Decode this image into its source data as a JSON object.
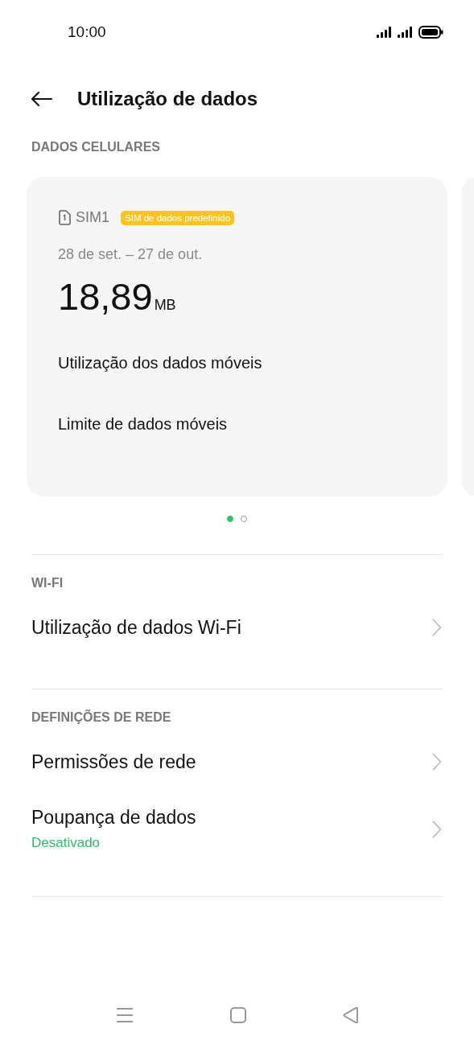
{
  "status_bar": {
    "time": "10:00"
  },
  "header": {
    "title": "Utilização de dados"
  },
  "cellular": {
    "heading": "DADOS CELULARES",
    "card": {
      "sim_label": "SIM1",
      "badge": "SIM de dados predefinido",
      "period": "28 de set. – 27 de out.",
      "amount": "18,89",
      "unit": "MB",
      "items": [
        "Utilização dos dados móveis",
        "Limite de dados móveis"
      ]
    },
    "pager": [
      {
        "selected": true
      },
      {
        "selected": false
      }
    ]
  },
  "sections": [
    {
      "heading": "WI-FI",
      "items": [
        {
          "label": "Utilização de dados Wi-Fi"
        }
      ]
    },
    {
      "heading": "DEFINIÇÕES DE REDE",
      "items": [
        {
          "label": "Permissões de rede"
        },
        {
          "label": "Poupança de dados",
          "subtitle": "Desativado"
        }
      ]
    }
  ]
}
